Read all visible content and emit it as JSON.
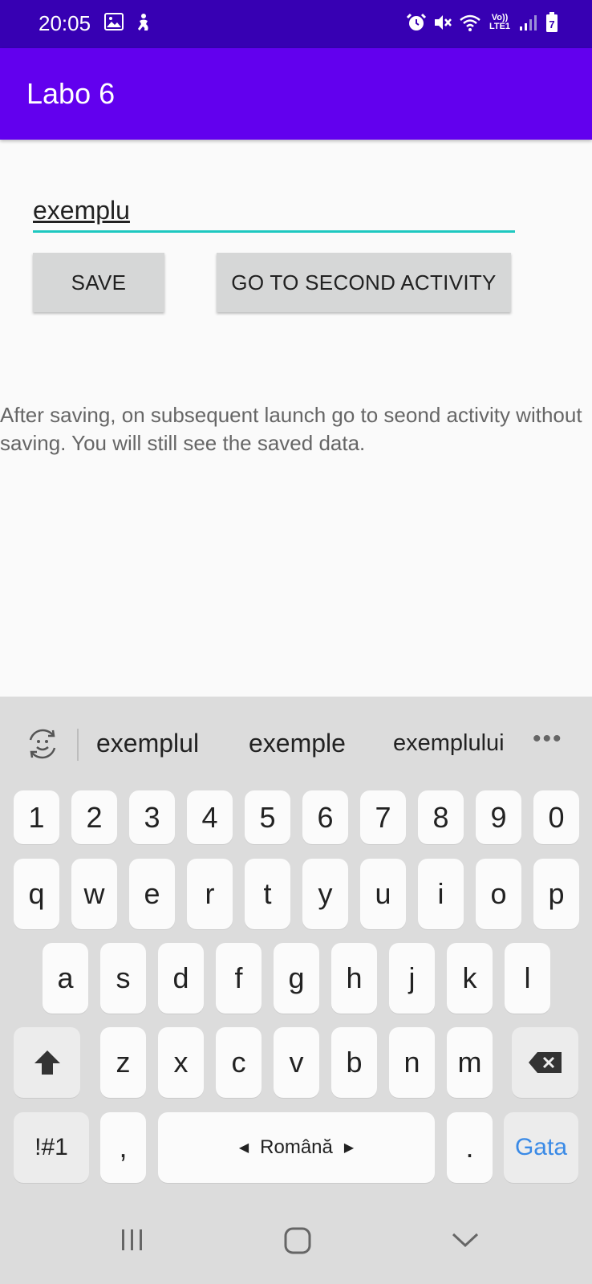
{
  "status_bar": {
    "time": "20:05",
    "network_label": "Vo)) LTE1"
  },
  "app_bar": {
    "title": "Labo 6"
  },
  "form": {
    "input_value": "exemplu",
    "save_label": "SAVE",
    "second_activity_label": "GO TO SECOND ACTIVITY",
    "helper_text": "After saving, on subsequent launch go to seond activity without saving. You will still see the saved data."
  },
  "keyboard": {
    "suggestions": [
      "exemplul",
      "exemple",
      "exemplului"
    ],
    "rows": {
      "numbers": [
        "1",
        "2",
        "3",
        "4",
        "5",
        "6",
        "7",
        "8",
        "9",
        "0"
      ],
      "row1": [
        "q",
        "w",
        "e",
        "r",
        "t",
        "y",
        "u",
        "i",
        "o",
        "p"
      ],
      "row2": [
        "a",
        "s",
        "d",
        "f",
        "g",
        "h",
        "j",
        "k",
        "l"
      ],
      "row3": [
        "z",
        "x",
        "c",
        "v",
        "b",
        "n",
        "m"
      ]
    },
    "symbols_label": "!#1",
    "comma_label": ",",
    "space_label": "Română",
    "period_label": ".",
    "action_label": "Gata",
    "accent_color": "#3a8ae6"
  },
  "colors": {
    "status_bar": "#3700b3",
    "app_bar": "#6200ee",
    "input_underline": "#1ec8c0"
  }
}
